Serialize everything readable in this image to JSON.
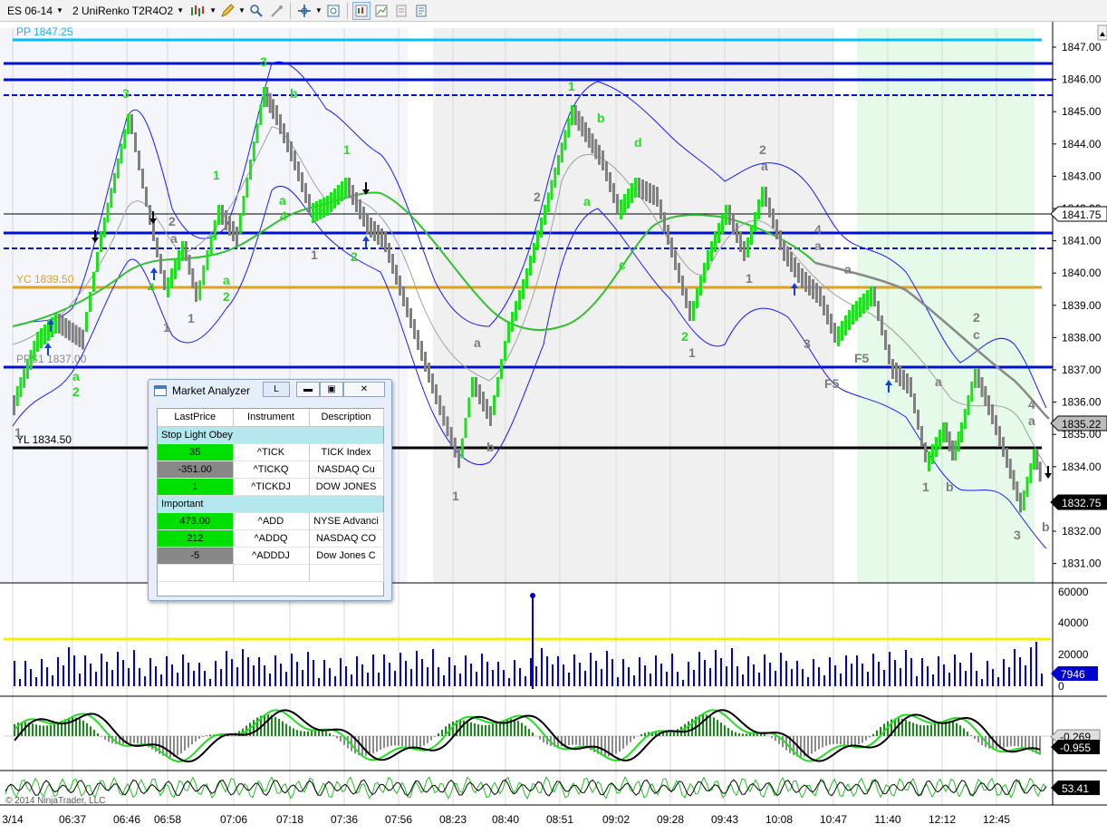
{
  "toolbar": {
    "instrument": "ES 06-14",
    "bar_type": "2 UniRenko T2R4O2",
    "icons": [
      "bar-type-icon",
      "pencil-icon",
      "zoom-icon",
      "magnet-icon",
      "crosshair-icon",
      "data-box-icon",
      "strategy-icon",
      "chart-style-icon",
      "properties-icon",
      "template-icon"
    ]
  },
  "chart": {
    "price_levels": {
      "pp": "PP 1847.25",
      "yc": "YC 1839.50",
      "pps1": "PPS1 1837.00",
      "yl": "YL 1834.50"
    },
    "price_axis": [
      "1847.00",
      "1846.00",
      "1845.00",
      "1844.00",
      "1843.00",
      "1842.00",
      "1841.00",
      "1840.00",
      "1839.00",
      "1838.00",
      "1837.00",
      "1836.00",
      "1835.00",
      "1834.00",
      "1833.00",
      "1832.00",
      "1831.00"
    ],
    "price_flags": {
      "f1841": "1841.75",
      "f1835": "1835.22",
      "last": "1832.75"
    },
    "time_axis": [
      "3/14",
      "06:37",
      "06:46",
      "06:58",
      "07:06",
      "07:18",
      "07:36",
      "07:56",
      "08:23",
      "08:40",
      "08:51",
      "09:02",
      "09:28",
      "09:43",
      "10:08",
      "10:47",
      "11:40",
      "12:12",
      "12:45"
    ],
    "volume_axis": [
      "60000",
      "40000",
      "20000",
      "0"
    ],
    "volume_flag": "7946",
    "macd_flags": {
      "a": "-0.269",
      "b": "-0.955"
    },
    "stoch_flag": "53.41",
    "copyright": "© 2014 NinjaTrader, LLC",
    "wave_labels": [
      {
        "t": "1",
        "c": "gray"
      },
      {
        "t": "a",
        "c": "green"
      },
      {
        "t": "2",
        "c": "green"
      },
      {
        "t": "3",
        "c": "green"
      },
      {
        "t": "4",
        "c": "green"
      },
      {
        "t": "a",
        "c": "green"
      },
      {
        "t": "2",
        "c": "green"
      },
      {
        "t": "1",
        "c": "green"
      },
      {
        "t": "3",
        "c": "green"
      },
      {
        "t": "b",
        "c": "green"
      },
      {
        "t": "a",
        "c": "green"
      },
      {
        "t": "4",
        "c": "green"
      },
      {
        "t": "1",
        "c": "green"
      },
      {
        "t": "2",
        "c": "green"
      },
      {
        "t": "1",
        "c": "gray"
      },
      {
        "t": "2",
        "c": "gray"
      },
      {
        "t": "a",
        "c": "gray"
      },
      {
        "t": "1",
        "c": "gray"
      },
      {
        "t": "1",
        "c": "gray"
      },
      {
        "t": "a",
        "c": "gray"
      },
      {
        "t": "b",
        "c": "gray"
      },
      {
        "t": "1",
        "c": "gray"
      },
      {
        "t": "2",
        "c": "gray"
      },
      {
        "t": "a",
        "c": "green"
      },
      {
        "t": "1",
        "c": "green"
      },
      {
        "t": "b",
        "c": "green"
      },
      {
        "t": "d",
        "c": "green"
      },
      {
        "t": "c",
        "c": "green"
      },
      {
        "t": "2",
        "c": "green"
      },
      {
        "t": "1",
        "c": "gray"
      },
      {
        "t": "2",
        "c": "gray"
      },
      {
        "t": "a",
        "c": "gray"
      },
      {
        "t": "1",
        "c": "gray"
      },
      {
        "t": "4",
        "c": "gray"
      },
      {
        "t": "a",
        "c": "gray"
      },
      {
        "t": "3",
        "c": "gray"
      },
      {
        "t": "a",
        "c": "gray"
      },
      {
        "t": "F5",
        "c": "gray"
      },
      {
        "t": "F5",
        "c": "gray"
      },
      {
        "t": "1",
        "c": "gray"
      },
      {
        "t": "a",
        "c": "gray"
      },
      {
        "t": "b",
        "c": "gray"
      },
      {
        "t": "2",
        "c": "gray"
      },
      {
        "t": "c",
        "c": "gray"
      },
      {
        "t": "4",
        "c": "gray"
      },
      {
        "t": "a",
        "c": "gray"
      },
      {
        "t": "3",
        "c": "gray"
      },
      {
        "t": "b",
        "c": "gray"
      }
    ],
    "colors": {
      "blue_line": "#0000d0",
      "pp_line": "#00bfff",
      "yc_line": "#e0a020",
      "bull": "#22dd22",
      "bear": "#888888",
      "session_shade": "#f0f0f0",
      "late_shade": "#e4fbe8"
    }
  },
  "market_analyzer": {
    "title": "Market Analyzer",
    "link_button": "L",
    "columns": [
      "LastPrice",
      "Instrument",
      "Description"
    ],
    "groups": [
      {
        "name": "Stop Light Obey",
        "rows": [
          {
            "last": "35",
            "instrument": "^TICK",
            "description": "TICK Index",
            "state": "green"
          },
          {
            "last": "-351.00",
            "instrument": "^TICKQ",
            "description": "NASDAQ Cu",
            "state": "gray"
          },
          {
            "last": "1",
            "instrument": "^TICKDJ",
            "description": "DOW JONES",
            "state": "green"
          }
        ]
      },
      {
        "name": "Important",
        "rows": [
          {
            "last": "473.00",
            "instrument": "^ADD",
            "description": "NYSE Advanci",
            "state": "green"
          },
          {
            "last": "212",
            "instrument": "^ADDQ",
            "description": "NASDAQ CO",
            "state": "green"
          },
          {
            "last": "-5",
            "instrument": "^ADDDJ",
            "description": "Dow Jones C",
            "state": "gray"
          }
        ]
      }
    ]
  }
}
